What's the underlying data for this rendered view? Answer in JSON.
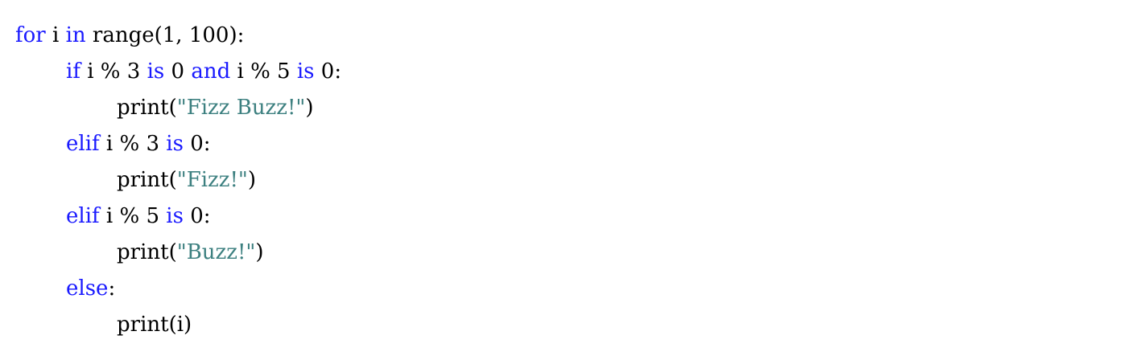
{
  "code": {
    "colors": {
      "keyword": "#1a1aff",
      "string": "#3d8080",
      "text": "#000000",
      "background": "#ffffff"
    },
    "lines": [
      {
        "indent": 0,
        "tokens": [
          {
            "t": "kw",
            "v": "for"
          },
          {
            "t": "plain",
            "v": " i "
          },
          {
            "t": "kw",
            "v": "in"
          },
          {
            "t": "plain",
            "v": " range(1, 100):"
          }
        ]
      },
      {
        "indent": 1,
        "tokens": [
          {
            "t": "kw",
            "v": "if"
          },
          {
            "t": "plain",
            "v": " i % 3 "
          },
          {
            "t": "kw",
            "v": "is"
          },
          {
            "t": "plain",
            "v": " 0 "
          },
          {
            "t": "kw",
            "v": "and"
          },
          {
            "t": "plain",
            "v": " i % 5 "
          },
          {
            "t": "kw",
            "v": "is"
          },
          {
            "t": "plain",
            "v": " 0:"
          }
        ]
      },
      {
        "indent": 2,
        "tokens": [
          {
            "t": "plain",
            "v": "print("
          },
          {
            "t": "str",
            "v": "\"Fizz Buzz!\""
          },
          {
            "t": "plain",
            "v": ")"
          }
        ]
      },
      {
        "indent": 1,
        "tokens": [
          {
            "t": "kw",
            "v": "elif"
          },
          {
            "t": "plain",
            "v": " i % 3 "
          },
          {
            "t": "kw",
            "v": "is"
          },
          {
            "t": "plain",
            "v": " 0:"
          }
        ]
      },
      {
        "indent": 2,
        "tokens": [
          {
            "t": "plain",
            "v": "print("
          },
          {
            "t": "str",
            "v": "\"Fizz!\""
          },
          {
            "t": "plain",
            "v": ")"
          }
        ]
      },
      {
        "indent": 1,
        "tokens": [
          {
            "t": "kw",
            "v": "elif"
          },
          {
            "t": "plain",
            "v": " i % 5 "
          },
          {
            "t": "kw",
            "v": "is"
          },
          {
            "t": "plain",
            "v": " 0:"
          }
        ]
      },
      {
        "indent": 2,
        "tokens": [
          {
            "t": "plain",
            "v": "print("
          },
          {
            "t": "str",
            "v": "\"Buzz!\""
          },
          {
            "t": "plain",
            "v": ")"
          }
        ]
      },
      {
        "indent": 1,
        "tokens": [
          {
            "t": "kw",
            "v": "else"
          },
          {
            "t": "plain",
            "v": ":"
          }
        ]
      },
      {
        "indent": 2,
        "tokens": [
          {
            "t": "plain",
            "v": "print(i)"
          }
        ]
      }
    ]
  }
}
